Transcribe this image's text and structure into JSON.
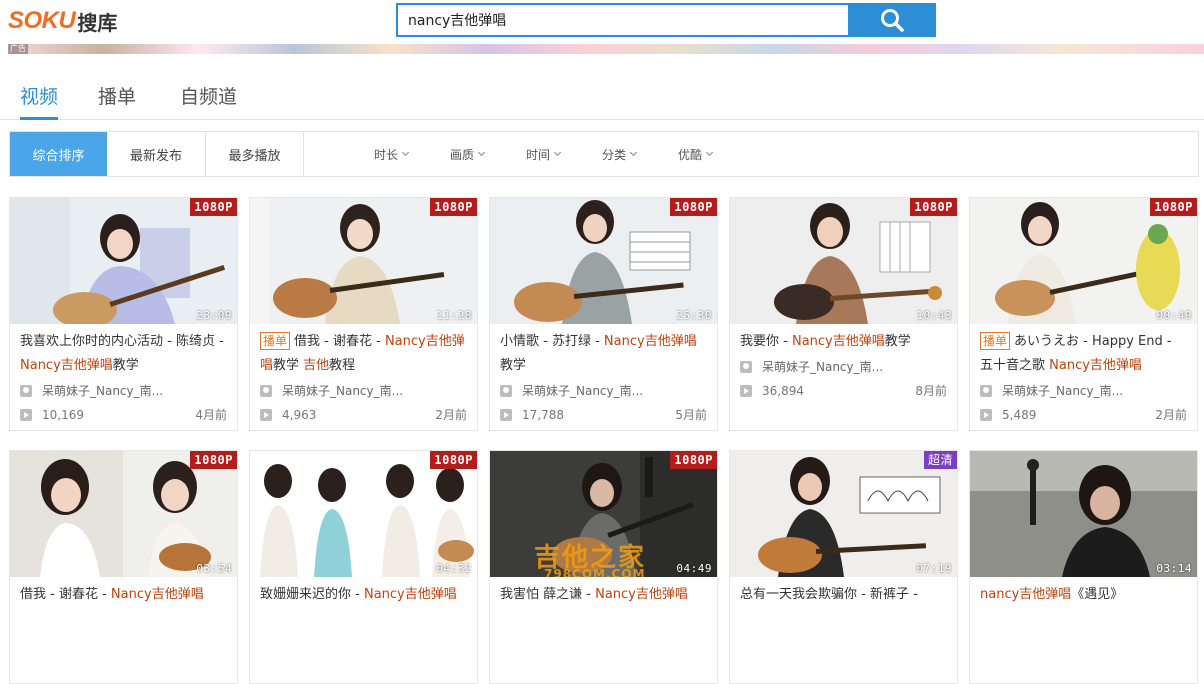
{
  "header": {
    "logo_en": "SOKU",
    "logo_cn": "搜库",
    "search_value": "nancy吉他弹唱",
    "banner_tag": "广告"
  },
  "tabs": [
    {
      "label": "视频",
      "active": true
    },
    {
      "label": "播单",
      "active": false
    },
    {
      "label": "自频道",
      "active": false
    }
  ],
  "filters": {
    "sort": [
      "综合排序",
      "最新发布",
      "最多播放"
    ],
    "dropdowns": [
      "时长",
      "画质",
      "时间",
      "分类",
      "优酷"
    ]
  },
  "colors": {
    "accent": "#2c8fd6",
    "highlight": "#c2410c",
    "badge_1080": "#b51c1c",
    "badge_hd": "#7b3fc4"
  },
  "videos": [
    {
      "badge": "1080P",
      "duration": "23:09",
      "tag": "",
      "title_parts": [
        "我喜欢上你时的内心活动 - 陈绮贞 - ",
        "Nancy吉他弹唱",
        "教学"
      ],
      "author": "呆萌妹子_Nancy_南...",
      "views": "10,169",
      "ago": "4月前"
    },
    {
      "badge": "1080P",
      "duration": "11:28",
      "tag": "播单",
      "title_parts": [
        "借我 - 谢春花 - ",
        "Nancy吉他弹唱",
        "教学 ",
        "吉他",
        "教程"
      ],
      "author": "呆萌妹子_Nancy_南...",
      "views": "4,963",
      "ago": "2月前"
    },
    {
      "badge": "1080P",
      "duration": "25:30",
      "tag": "",
      "title_parts": [
        "小情歌 - 苏打绿 - ",
        "Nancy吉他弹唱",
        "教学"
      ],
      "author": "呆萌妹子_Nancy_南...",
      "views": "17,788",
      "ago": "5月前"
    },
    {
      "badge": "1080P",
      "duration": "10:43",
      "tag": "",
      "title_parts": [
        "我要你 - ",
        "Nancy吉他弹唱",
        "教学"
      ],
      "author": "呆萌妹子_Nancy_南...",
      "views": "36,894",
      "ago": "8月前"
    },
    {
      "badge": "1080P",
      "duration": "00:49",
      "tag": "播单",
      "title_parts": [
        "あいうえお - Happy End - 五十音之歌 ",
        "Nancy吉他弹唱",
        ""
      ],
      "author": "呆萌妹子_Nancy_南...",
      "views": "5,489",
      "ago": "2月前"
    },
    {
      "badge": "1080P",
      "duration": "03:54",
      "tag": "",
      "title_parts": [
        "借我 - 谢春花 - ",
        "Nancy吉他弹唱",
        ""
      ],
      "author": "",
      "views": "",
      "ago": ""
    },
    {
      "badge": "1080P",
      "duration": "04:32",
      "tag": "",
      "title_parts": [
        "致姗姗来迟的你 - ",
        "Nancy吉他弹唱",
        ""
      ],
      "author": "",
      "views": "",
      "ago": ""
    },
    {
      "badge": "1080P",
      "duration": "04:49",
      "tag": "",
      "title_parts": [
        "我害怕 薛之谦 - ",
        "Nancy吉他弹唱",
        ""
      ],
      "author": "",
      "views": "",
      "ago": "",
      "watermark": "吉他之家",
      "watermark_sub": "798COM.COM"
    },
    {
      "badge": "超清",
      "duration": "07:19",
      "tag": "",
      "title_parts": [
        "总有一天我会欺骗你 - 新裤子 - ",
        "",
        ""
      ],
      "author": "",
      "views": "",
      "ago": ""
    },
    {
      "badge": "",
      "duration": "03:14",
      "tag": "",
      "title_parts": [
        "",
        "nancy吉他弹唱",
        "《遇见》"
      ],
      "author": "",
      "views": "",
      "ago": ""
    }
  ]
}
